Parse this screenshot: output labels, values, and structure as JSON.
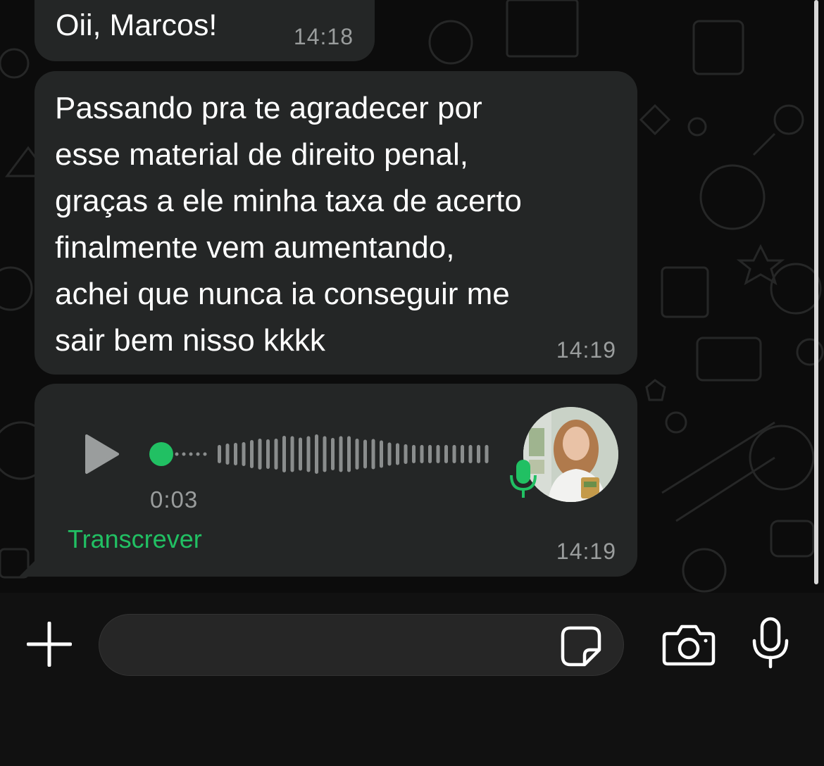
{
  "messages": [
    {
      "text": "Oii, Marcos!",
      "time": "14:18"
    },
    {
      "text": "Passando pra te agradecer por\nesse material de direito penal,\ngraças a ele minha taxa de acerto\nfinalmente vem aumentando,\nachei que nunca ia conseguir me\nsair bem nisso kkkk",
      "time": "14:19"
    }
  ],
  "voice_message": {
    "duration": "0:03",
    "progress": 0,
    "transcribe_label": "Transcrever",
    "time": "14:19",
    "icons": [
      "play-icon",
      "microphone-icon"
    ]
  },
  "composer": {
    "placeholder": "",
    "icons": [
      "plus-icon",
      "sticker-icon",
      "camera-icon",
      "microphone-icon"
    ]
  },
  "colors": {
    "accent": "#21c063",
    "bubble": "#242626",
    "background": "#0c0c0c",
    "meta_text": "#9a9d9d"
  }
}
